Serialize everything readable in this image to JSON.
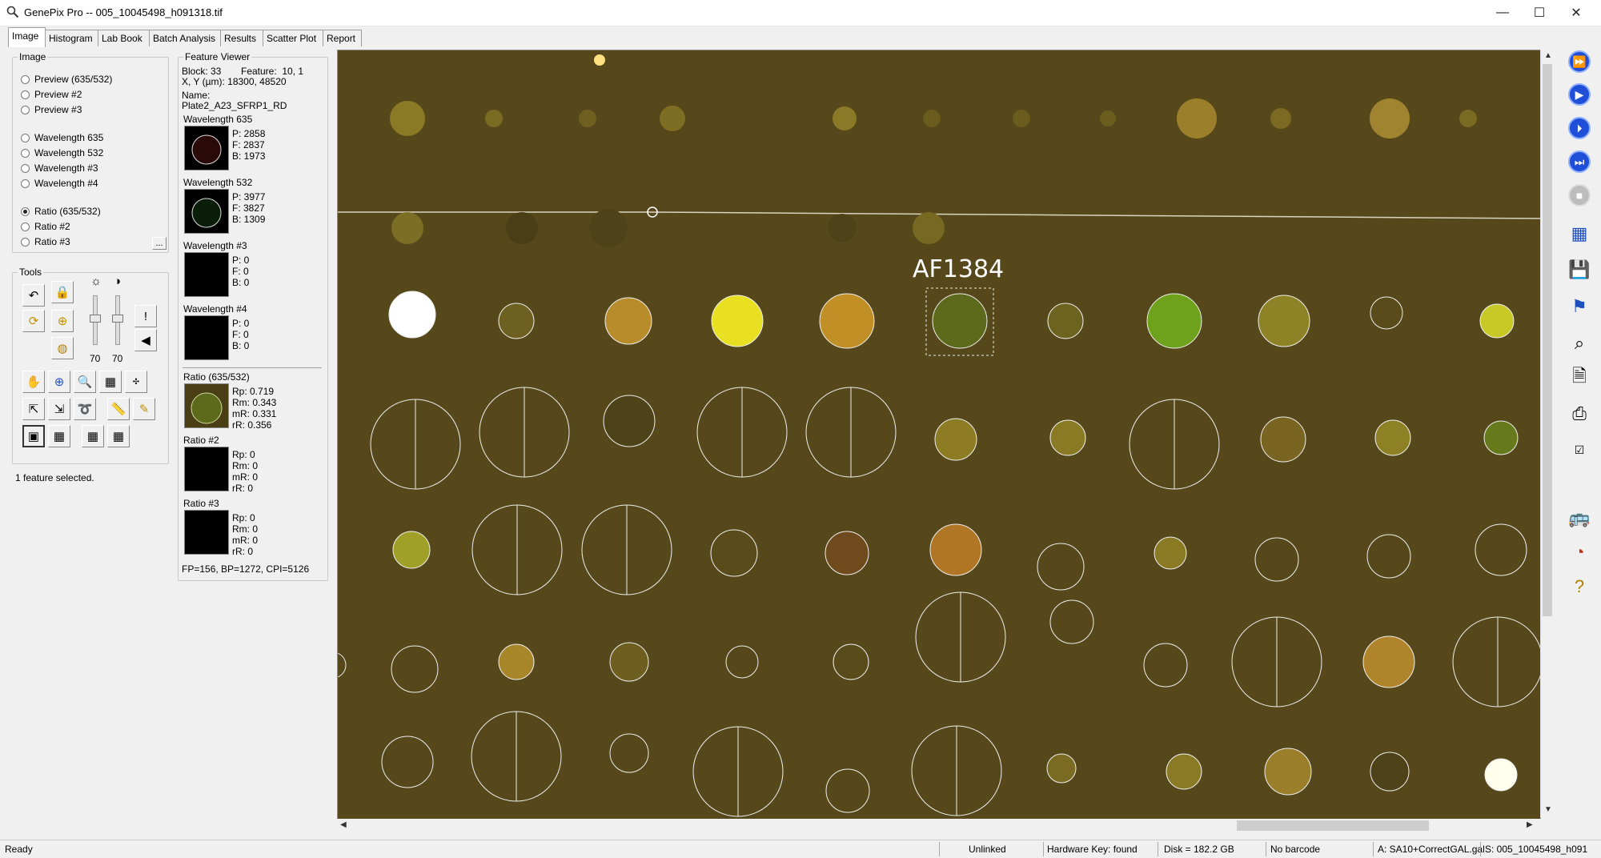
{
  "window": {
    "title": "GenePix Pro -- 005_10045498_h091318.tif",
    "controls": [
      "—",
      "☐",
      "✕"
    ]
  },
  "tabs": [
    "Image",
    "Histogram",
    "Lab Book",
    "Batch Analysis",
    "Results",
    "Scatter Plot",
    "Report"
  ],
  "image_group": {
    "label": "Image",
    "options": [
      "Preview (635/532)",
      "Preview #2",
      "Preview #3",
      "Wavelength 635",
      "Wavelength 532",
      "Wavelength #3",
      "Wavelength #4",
      "Ratio (635/532)",
      "Ratio #2",
      "Ratio #3"
    ],
    "selected": "Ratio (635/532)",
    "more": "..."
  },
  "tools_group": {
    "label": "Tools",
    "slider_values": [
      "70",
      "70"
    ]
  },
  "selection_status": "1 feature selected.",
  "feature_viewer": {
    "label": "Feature Viewer",
    "block": "Block: 33",
    "feature": "Feature:  10, 1",
    "xy": "X, Y (µm): 18300, 48520",
    "name_label": "Name:",
    "name": "Plate2_A23_SFRP1_RD",
    "channels": [
      {
        "label": "Wavelength 635",
        "lines": [
          "P:   2858",
          "F:   2837",
          "B:   1973"
        ]
      },
      {
        "label": "Wavelength 532",
        "lines": [
          "P:   3977",
          "F:   3827",
          "B:   1309"
        ]
      },
      {
        "label": "Wavelength #3",
        "lines": [
          "P:   0",
          "F:   0",
          "B:   0"
        ]
      },
      {
        "label": "Wavelength #4",
        "lines": [
          "P:   0",
          "F:   0",
          "B:   0"
        ]
      }
    ],
    "ratios": [
      {
        "label": "Ratio (635/532)",
        "lines": [
          "Rp:  0.719",
          "Rm:  0.343",
          "mR:  0.331",
          "rR:  0.356"
        ]
      },
      {
        "label": "Ratio #2",
        "lines": [
          "Rp:  0",
          "Rm:  0",
          "mR:  0",
          "rR:  0"
        ]
      },
      {
        "label": "Ratio #3",
        "lines": [
          "Rp:  0",
          "Rm:  0",
          "mR:  0",
          "rR:  0"
        ]
      }
    ],
    "footer": "FP=156, BP=1272, CPI=5126"
  },
  "viewer": {
    "feature_label": "AF1384",
    "background_color": "#56481a"
  },
  "statusbar": {
    "ready": "Ready",
    "link": "Unlinked",
    "hardware": "Hardware Key: found",
    "disk": "Disk = 182.2 GB",
    "barcode": "No barcode",
    "gal": "A: SA10+CorrectGAL.gal",
    "file": "S: 005_10045498_h091"
  }
}
